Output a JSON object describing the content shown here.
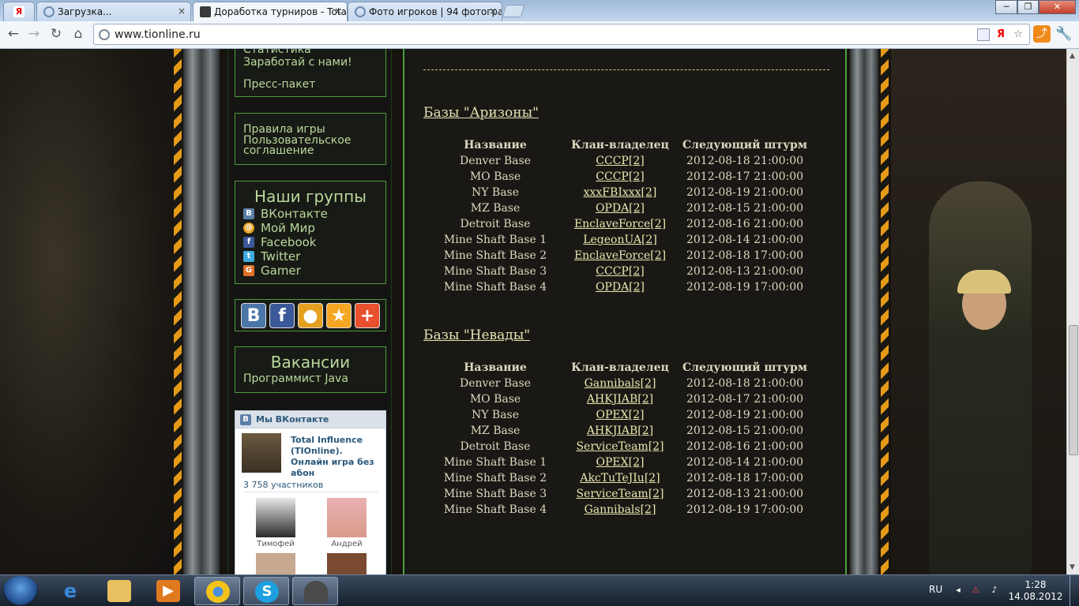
{
  "browser": {
    "tabs": [
      {
        "label": "Загрузка...",
        "active": false
      },
      {
        "label": "Доработка турниров - Total",
        "active": true
      },
      {
        "label": "Фото игроков | 94 фотогра",
        "active": false
      }
    ],
    "url": "www.tionline.ru",
    "yandex_tab_icon": "Я"
  },
  "sidebar": {
    "top_links": [
      "Статистика",
      "Заработай с нами!",
      "Пресс-пакет"
    ],
    "rules_links": [
      "Правила игры",
      "Пользовательское соглашение"
    ],
    "groups": {
      "title": "Наши группы",
      "items": [
        {
          "label": "ВКонтакте",
          "icon": "vk-icon",
          "color": "#5b7fa6"
        },
        {
          "label": "Мой Мир",
          "icon": "mymir-icon",
          "color": "#e6a020"
        },
        {
          "label": "Facebook",
          "icon": "facebook-icon",
          "color": "#3b5998"
        },
        {
          "label": "Twitter",
          "icon": "twitter-icon",
          "color": "#3fa9e0"
        },
        {
          "label": "Gamer",
          "icon": "gamer-icon",
          "color": "#e0702a"
        }
      ]
    },
    "share_icons": [
      {
        "glyph": "В",
        "icon": "vk-share-icon",
        "color": "#4a76a8"
      },
      {
        "glyph": "f",
        "icon": "facebook-share-icon",
        "color": "#3b5998"
      },
      {
        "glyph": "●",
        "icon": "mymir-share-icon",
        "color": "#e6a020"
      },
      {
        "glyph": "★",
        "icon": "favorite-star-icon",
        "color": "#f5a623"
      },
      {
        "glyph": "+",
        "icon": "add-plus-icon",
        "color": "#e8502e"
      }
    ],
    "vacancies": {
      "title": "Вакансии",
      "item": "Программист Java"
    },
    "vk_widget": {
      "header": "Мы ВКонтакте",
      "group_name": "Total Influence (TIOnline). Онлайн игра без абон",
      "members": "3 758 участников",
      "people": [
        "Тимофей",
        "Андрей"
      ]
    }
  },
  "content": {
    "sections": [
      {
        "title": "Базы \"Аризоны\"",
        "headers": [
          "Название",
          "Клан-владелец",
          "Следующий штурм"
        ],
        "rows": [
          [
            "Denver Base",
            "CCCP[2]",
            "2012-08-18 21:00:00"
          ],
          [
            "MO Base",
            "CCCP[2]",
            "2012-08-17 21:00:00"
          ],
          [
            "NY Base",
            "xxxFBIxxx[2]",
            "2012-08-19 21:00:00"
          ],
          [
            "MZ Base",
            "OPDA[2]",
            "2012-08-15 21:00:00"
          ],
          [
            "Detroit Base",
            "EnclaveForce[2]",
            "2012-08-16 21:00:00"
          ],
          [
            "Mine Shaft Base 1",
            "LegeonUA[2]",
            "2012-08-14 21:00:00"
          ],
          [
            "Mine Shaft Base 2",
            "EnclaveForce[2]",
            "2012-08-18 17:00:00"
          ],
          [
            "Mine Shaft Base 3",
            "CCCP[2]",
            "2012-08-13 21:00:00"
          ],
          [
            "Mine Shaft Base 4",
            "OPDA[2]",
            "2012-08-19 17:00:00"
          ]
        ]
      },
      {
        "title": "Базы \"Невады\"",
        "headers": [
          "Название",
          "Клан-владелец",
          "Следующий штурм"
        ],
        "rows": [
          [
            "Denver Base",
            "Gannibals[2]",
            "2012-08-18 21:00:00"
          ],
          [
            "MO Base",
            "AHKJIAB[2]",
            "2012-08-17 21:00:00"
          ],
          [
            "NY Base",
            "OPEX[2]",
            "2012-08-19 21:00:00"
          ],
          [
            "MZ Base",
            "AHKJIAB[2]",
            "2012-08-15 21:00:00"
          ],
          [
            "Detroit Base",
            "ServiceTeam[2]",
            "2012-08-16 21:00:00"
          ],
          [
            "Mine Shaft Base 1",
            "OPEX[2]",
            "2012-08-14 21:00:00"
          ],
          [
            "Mine Shaft Base 2",
            "AkcTuTeJIu[2]",
            "2012-08-18 17:00:00"
          ],
          [
            "Mine Shaft Base 3",
            "ServiceTeam[2]",
            "2012-08-13 21:00:00"
          ],
          [
            "Mine Shaft Base 4",
            "Gannibals[2]",
            "2012-08-19 17:00:00"
          ]
        ]
      }
    ]
  },
  "taskbar": {
    "language": "RU",
    "time": "1:28",
    "date": "14.08.2012",
    "apps": [
      "internet-explorer-icon",
      "file-explorer-icon",
      "media-player-icon",
      "chrome-icon",
      "skype-icon",
      "game-client-icon"
    ]
  }
}
